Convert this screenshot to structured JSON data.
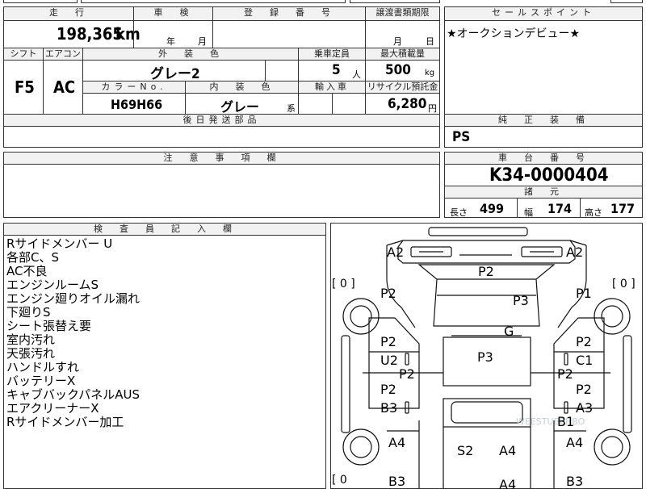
{
  "headers": {
    "mileage": "走　行",
    "inspection": "車　検",
    "registration": "登　録　番　号",
    "transfer": "譲渡書類期限",
    "sales_point": "セールスポイント",
    "shift": "シフト",
    "aircon": "エアコン",
    "exterior_color": "外　装　色",
    "capacity": "乗車定員",
    "max_load": "最大積載量",
    "color_no": "カラーNo.",
    "interior_color": "内　装　色",
    "import": "輸入車",
    "recycle": "リサイクル預託金",
    "later_parts": "後日発送部品",
    "equipment": "純　正　装　備",
    "notes": "注　意　事　項　欄",
    "chassis": "車　台　番　号",
    "specs": "諸　元",
    "inspector": "検　査　員　記　入　欄"
  },
  "values": {
    "mileage": "198,365",
    "mileage_unit": "km",
    "inspection_year": "年",
    "inspection_month": "月",
    "transfer_month": "月",
    "transfer_day": "日",
    "sales_point": "★オークションデビュー★",
    "shift": "F5",
    "aircon": "AC",
    "exterior_color": "グレー2",
    "capacity": "5",
    "capacity_unit": "人",
    "max_load": "500",
    "max_load_unit": "kg",
    "color_no": "H69H66",
    "interior_color": "グレー",
    "interior_suffix": "系",
    "recycle": "6,280",
    "recycle_unit": "円",
    "equipment": "PS",
    "chassis": "K34-0000404",
    "length_label": "長さ",
    "length": "499",
    "width_label": "幅",
    "width": "174",
    "height_label": "高さ",
    "height": "177"
  },
  "remarks": [
    "Rサイドメンバー U",
    "各部C、S",
    "AC不良",
    "エンジンルームS",
    "エンジン廻りオイル漏れ",
    "下廻りS",
    "シート張替え要",
    "室内汚れ",
    "天張汚れ",
    "ハンドルすれ",
    "バッテリーX",
    "キャブバックパネルAUS",
    "エアクリーナーX",
    "Rサイドメンバー加工"
  ],
  "diagram": {
    "bracket_left": "[ 0 ]",
    "bracket_right": "[ 0 ]",
    "bracket_bottom": "[ 0",
    "watermark": "WEESTUBEHBO",
    "marks": {
      "a2_left": "A2",
      "a2_right": "A2",
      "p2_front": "P2",
      "p2_left_fender": "P2",
      "p1_right_fender": "P1",
      "p3_hood": "P3",
      "g_glass": "G",
      "p2_ld1": "P2",
      "u2": "U2",
      "p2_rd1": "P2",
      "c1": "C1",
      "p3_roof": "P3",
      "p2_lsill": "P2",
      "p2_rsill": "P2",
      "p2_ld2": "P2",
      "b3_left": "B3",
      "p2_rd2": "P2",
      "a3": "A3",
      "b1": "B1",
      "a4_left": "A4",
      "a4_right": "A4",
      "s2": "S2",
      "a4_bed": "A4",
      "b3_bl": "B3",
      "a4_bb": "A4",
      "b3_br": "B3"
    }
  }
}
